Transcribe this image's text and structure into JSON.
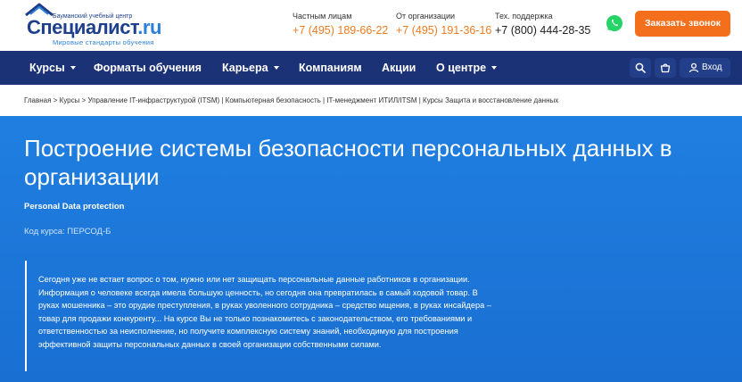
{
  "header": {
    "logo": {
      "tagline": "Бауманский учебный центр",
      "brand_main": "Специалист",
      "brand_tld": ".ru",
      "slogan": "Мировые стандарты обучения"
    },
    "contacts": [
      {
        "label": "Частным лицам",
        "phone": "+7 (495) 189-66-22"
      },
      {
        "label": "От организации",
        "phone": "+7 (495) 191-36-16"
      },
      {
        "label": "Тех. поддержка",
        "phone": "+7 (800) 444-28-35"
      }
    ],
    "callback_label": "Заказать звонок"
  },
  "nav": {
    "items": [
      {
        "label": "Курсы",
        "has_dropdown": true
      },
      {
        "label": "Форматы обучения",
        "has_dropdown": false
      },
      {
        "label": "Карьера",
        "has_dropdown": true
      },
      {
        "label": "Компаниям",
        "has_dropdown": false
      },
      {
        "label": "Акции",
        "has_dropdown": false
      },
      {
        "label": "О центре",
        "has_dropdown": true
      }
    ],
    "login_label": "Вход"
  },
  "breadcrumb": "Главная > Курсы > Управление IT-инфраструктурой (ITSM) | Компьютерная безопасность | IT-менеджмент ИТИЛ/ITSM | Курсы Защита и восстановление данных",
  "hero": {
    "title": "Построение системы безопасности персональных данных в организации",
    "subtitle": "Personal Data protection",
    "course_code": "Код курса: ПЕРСОД-Б",
    "description": "Сегодня уже не встает вопрос о том, нужно или нет защищать персональные данные работников в организации. Информация о человеке всегда имела большую ценность, но сегодня она превратилась в самый ходовой товар. В руках мошенника – это орудие преступления, в руках уволенного сотрудника – средство мщения, в руках инсайдера – товар для продажи конкуренту... На курсе Вы не только познакомитесь с законодательством, его требованиями и ответственностью за неисполнение, но получите комплексную систему знаний, необходимую для построения эффективной защиты персональных данных в своей организации собственными силами."
  },
  "colors": {
    "brand_dark": "#1b3276",
    "brand_blue": "#1e3f8c",
    "accent_orange": "#f36f1c",
    "hero_blue": "#1f7fe0",
    "whatsapp_green": "#25d366"
  },
  "icons": [
    "whatsapp-icon",
    "search-icon",
    "cart-icon",
    "user-icon",
    "chevron-down-icon"
  ]
}
